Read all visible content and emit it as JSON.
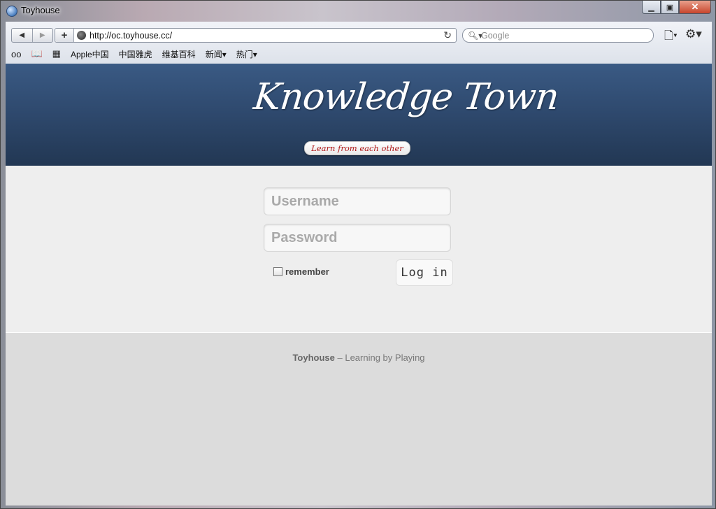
{
  "window": {
    "title": "Toyhouse"
  },
  "toolbar": {
    "back_icon": "◀",
    "forward_icon": "▶",
    "new_tab_icon": "+",
    "url": "http://oc.toyhouse.cc/",
    "reload_icon": "↻",
    "search_placeholder": "Google",
    "page_menu_icon": "🗋▾",
    "gear_menu_icon": "⚙▾"
  },
  "bookmarks": {
    "reader_icon": "oo",
    "book_icon": "📖",
    "grid_icon": "▦",
    "items": [
      "Apple中国",
      "中国雅虎",
      "维基百科",
      "新闻▾",
      "热门▾"
    ]
  },
  "banner": {
    "logo_text": "Knowledge Town",
    "tagline": "Learn from each other"
  },
  "login": {
    "username_placeholder": "Username",
    "password_placeholder": "Password",
    "remember_label": "remember",
    "login_button": "Log in"
  },
  "footer": {
    "brand": "Toyhouse",
    "slogan": " – Learning by Playing"
  }
}
